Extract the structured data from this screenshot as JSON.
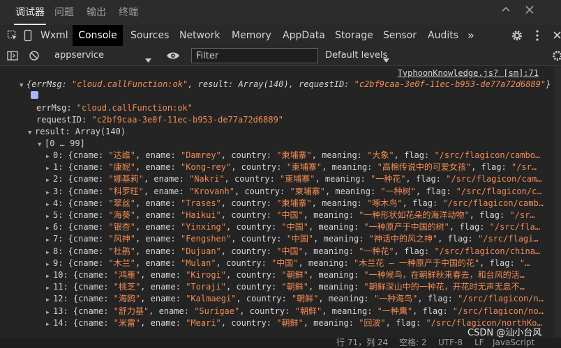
{
  "top_tabs": [
    "调试器",
    "问题",
    "输出",
    "终端"
  ],
  "devtools_tabs": [
    "Wxml",
    "Console",
    "Sources",
    "Network",
    "Memory",
    "AppData",
    "Storage",
    "Sensor",
    "Audits"
  ],
  "more_tabs_glyph": "»",
  "toolbar": {
    "context": "appservice",
    "filter_placeholder": "Filter",
    "levels": "Default levels"
  },
  "console": {
    "source_link": "TyphoonKnowledge.js? [sm]:71",
    "summary_prefix": "{errMsg: ",
    "summary_errmsg": "\"cloud.callFunction:ok\"",
    "summary_mid": ", result: Array(140), requestID: ",
    "summary_reqid": "\"c2bf9caa-3e0f-11ec-b953-de77a72d6889\"",
    "summary_suffix": "}",
    "errmsg_key": "errMsg: ",
    "errmsg_val": "\"cloud.callFunction:ok\"",
    "reqid_key": "requestID: ",
    "reqid_val": "\"c2bf9caa-3e0f-11ec-b953-de77a72d6889\"",
    "result_label": "result: Array(140)",
    "range_label": "[0 … 99]",
    "rows": [
      {
        "idx": "0:",
        "cname": "\"达维\"",
        "ename": "\"Damrey\"",
        "country": "\"柬埔寨\"",
        "meaning": "\"大象\"",
        "flag": "\"/src/flagicon/cambo…"
      },
      {
        "idx": "1:",
        "cname": "\"康妮\"",
        "ename": "\"Kong-rey\"",
        "country": "\"柬埔寨\"",
        "meaning": "\"高棉传说中的可爱女孩\"",
        "flag": "\"/sr…"
      },
      {
        "idx": "2:",
        "cname": "\"娜基莉\"",
        "ename": "\"Nakri\"",
        "country": "\"柬埔寨\"",
        "meaning": "\"一种花\"",
        "flag": "\"/src/flagicon/cam…"
      },
      {
        "idx": "3:",
        "cname": "\"科罗旺\"",
        "ename": "\"Krovanh\"",
        "country": "\"柬埔寨\"",
        "meaning": "\"一种树\"",
        "flag": "\"/src/flagicon/c…"
      },
      {
        "idx": "4:",
        "cname": "\"翠丝\"",
        "ename": "\"Trases\"",
        "country": "\"柬埔寨\"",
        "meaning": "\"啄木鸟\"",
        "flag": "\"/src/flagicon/camb…"
      },
      {
        "idx": "5:",
        "cname": "\"海葵\"",
        "ename": "\"Haikui\"",
        "country": "\"中国\"",
        "meaning": "\"一种形状如花朵的海洋动物\"",
        "flag": "\"/sr…"
      },
      {
        "idx": "6:",
        "cname": "\"银杏\"",
        "ename": "\"Yinxing\"",
        "country": "\"中国\"",
        "meaning": "\"一种原产于中国的树\"",
        "flag": "\"/src/fla…"
      },
      {
        "idx": "7:",
        "cname": "\"风神\"",
        "ename": "\"Fengshen\"",
        "country": "\"中国\"",
        "meaning": "\"神话中的风之神\"",
        "flag": "\"/src/flagi…"
      },
      {
        "idx": "8:",
        "cname": "\"杜鹃\"",
        "ename": "\"Dujuan\"",
        "country": "\"中国\"",
        "meaning": "\"一种花\"",
        "flag": "\"/src/flagicon/china…"
      },
      {
        "idx": "9:",
        "cname": "\"木兰\"",
        "ename": "\"Mulan\"",
        "country": "\"中国\"",
        "meaning": "\"木兰花 — 一种原产于中国的花\"",
        "flag": "\"…"
      },
      {
        "idx": "10:",
        "cname": "\"鸿雁\"",
        "ename": "\"Kirogi\"",
        "country": "\"朝鲜\"",
        "meaning": "\"一种候鸟，在朝鲜秋来春去，和台风的活…"
      },
      {
        "idx": "11:",
        "cname": "\"桃芝\"",
        "ename": "\"Toraji\"",
        "country": "\"朝鲜\"",
        "meaning": "\"朝鲜深山中的一种花，开花时无声无息不…"
      },
      {
        "idx": "12:",
        "cname": "\"海鸥\"",
        "ename": "\"Kalmaegi\"",
        "country": "\"朝鲜\"",
        "meaning": "\"一种海鸟\"",
        "flag": "\"/src/flagicon/n…"
      },
      {
        "idx": "13:",
        "cname": "\"舒力基\"",
        "ename": "\"Surigae\"",
        "country": "\"朝鲜\"",
        "meaning": "\"一种鹰\"",
        "flag": "\"/src/flagicon/no…"
      },
      {
        "idx": "14:",
        "cname": "\"米雷\"",
        "ename": "\"Meari\"",
        "country": "\"朝鲜\"",
        "meaning": "\"回波\"",
        "flag": "\"/src/flagicon/northKo…"
      }
    ]
  },
  "status_bar": {
    "position": "行 71，列 24",
    "spaces": "空格: 2",
    "encoding": "UTF-8",
    "eol": "LF",
    "language": "JavaScript",
    "watermark": "CSDN @汕小台风"
  },
  "colors": {
    "background": "#242424",
    "string": "#f28b54",
    "active_tab": "#000000",
    "info_square": "#a9b5ff"
  }
}
